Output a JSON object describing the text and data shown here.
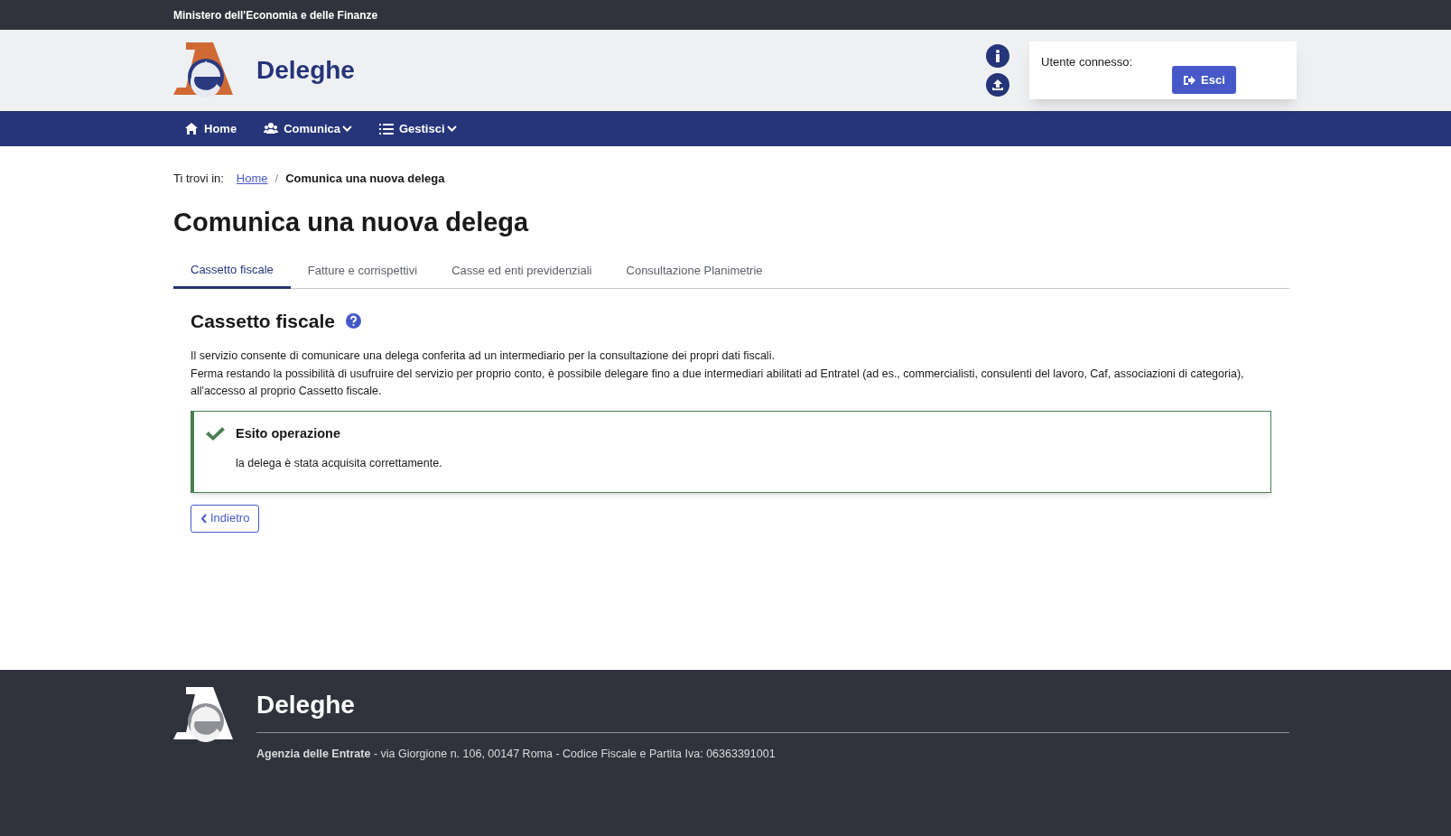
{
  "top_bar": {
    "ministry": "Ministero dell'Economia e delle Finanze"
  },
  "header": {
    "title": "Deleghe",
    "user_label": "Utente connesso:",
    "logout_button": "Esci"
  },
  "nav": [
    {
      "label": "Home",
      "kind": "home",
      "dropdown": false
    },
    {
      "label": "Comunica",
      "kind": "users",
      "dropdown": true
    },
    {
      "label": "Gestisci",
      "kind": "list",
      "dropdown": true
    }
  ],
  "breadcrumb": {
    "prefix": "Ti trovi in:",
    "separator": "/",
    "items": [
      {
        "label": "Home",
        "current": false
      },
      {
        "label": "Comunica una nuova delega",
        "current": true
      }
    ]
  },
  "page_title": "Comunica una nuova delega",
  "tabs": [
    {
      "label": "Cassetto fiscale",
      "selected": true
    },
    {
      "label": "Fatture e corrispettivi",
      "selected": false
    },
    {
      "label": "Casse ed enti previdenziali",
      "selected": false
    },
    {
      "label": "Consultazione Planimetrie",
      "selected": false
    }
  ],
  "section": {
    "title": "Cassetto fiscale",
    "paragraphs": [
      "Il servizio consente di comunicare una delega conferita ad un intermediario per la consultazione dei propri dati fiscali.",
      "Ferma restando la possibilità di usufruire del servizio per proprio conto, è possibile delegare fino a due intermediari abilitati ad Entratel (ad es., commercialisti, consulenti del lavoro, Caf, associazioni di categoria), all'accesso al proprio Cassetto fiscale."
    ]
  },
  "alert": {
    "kind": "success",
    "title": "Esito operazione",
    "message": "la delega è stata acquisita correttamente."
  },
  "back_button": "Indietro",
  "footer": {
    "title": "Deleghe",
    "agency": "Agenzia delle Entrate",
    "address": " - via Giorgione n. 106, 00147 Roma - Codice Fiscale e Partita Iva: 06363391001"
  }
}
